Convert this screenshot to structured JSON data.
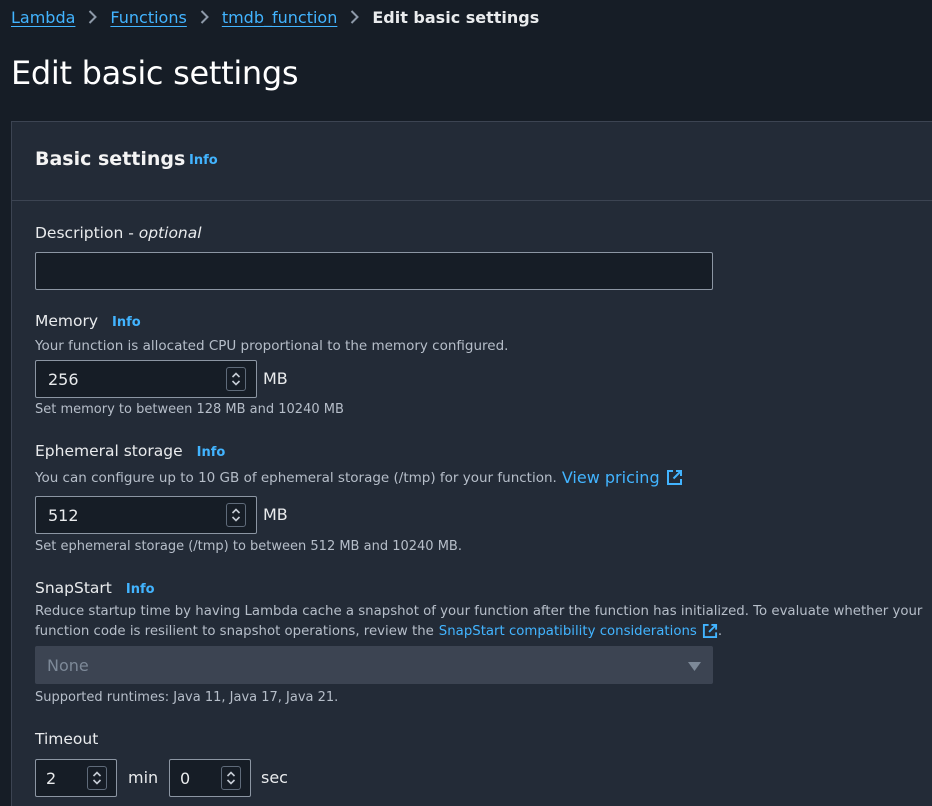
{
  "breadcrumb": {
    "items": [
      "Lambda",
      "Functions",
      "tmdb_function"
    ],
    "current": "Edit basic settings"
  },
  "page_title": "Edit basic settings",
  "panel": {
    "title": "Basic settings",
    "info": "Info"
  },
  "description_field": {
    "label": "Description - ",
    "optional": "optional",
    "value": ""
  },
  "memory": {
    "label": "Memory",
    "info": "Info",
    "description": "Your function is allocated CPU proportional to the memory configured.",
    "value": "256",
    "unit": "MB",
    "hint": "Set memory to between 128 MB and 10240 MB"
  },
  "ephemeral": {
    "label": "Ephemeral storage",
    "info": "Info",
    "description": "You can configure up to 10 GB of ephemeral storage (/tmp) for your function.",
    "link": "View pricing",
    "value": "512",
    "unit": "MB",
    "hint": "Set ephemeral storage (/tmp) to between 512 MB and 10240 MB."
  },
  "snapstart": {
    "label": "SnapStart",
    "info": "Info",
    "description_line1": "Reduce startup time by having Lambda cache a snapshot of your function after the function has initialized. To evaluate whether your",
    "description_line2": "function code is resilient to snapshot operations, review the",
    "link": "SnapStart compatibility considerations",
    "period": ".",
    "value": "None",
    "hint": "Supported runtimes: Java 11, Java 17, Java 21."
  },
  "timeout": {
    "label": "Timeout",
    "min_value": "2",
    "min_unit": "min",
    "sec_value": "0",
    "sec_unit": "sec"
  },
  "colors": {
    "background": "#161d26",
    "panel": "#232b37",
    "link": "#42b4ff"
  }
}
